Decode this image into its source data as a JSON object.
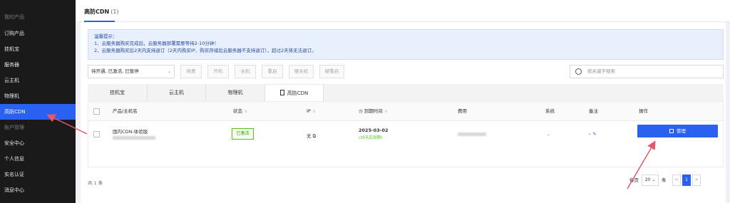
{
  "sidebar": {
    "items": [
      {
        "label": "我的产品",
        "type": "group"
      },
      {
        "label": "订购产品",
        "type": "item"
      },
      {
        "label": "挂机宝",
        "type": "item"
      },
      {
        "label": "服务器",
        "type": "item"
      },
      {
        "label": "云主机",
        "type": "item"
      },
      {
        "label": "物理机",
        "type": "item"
      },
      {
        "label": "高防CDN",
        "type": "active"
      },
      {
        "label": "账户管理",
        "type": "group"
      },
      {
        "label": "安全中心",
        "type": "item"
      },
      {
        "label": "个人信息",
        "type": "item"
      },
      {
        "label": "实名认证",
        "type": "item"
      },
      {
        "label": "消息中心",
        "type": "item"
      }
    ]
  },
  "header": {
    "title": "高防CDN",
    "count": "(1)"
  },
  "notice": {
    "title": "温馨提示：",
    "line1": "1、云服务器购买完成后，云服务器部署需要等待2-10分钟！",
    "line2": "2、云服务器购买后2天内支持退订（2天内购买IP、购买存储后云服务器不支持退订），超过2天将无法退订。"
  },
  "toolbar": {
    "status_filter": "待开通, 已激活, 已暂停",
    "buttons": [
      "续费",
      "开机",
      "关机",
      "重启",
      "硬关机",
      "硬重启"
    ],
    "search_placeholder": "按关键字搜索"
  },
  "tabs": [
    "挂机宝",
    "云主机",
    "物理机",
    "高防CDN"
  ],
  "table": {
    "columns": {
      "product": "产品/主机名",
      "status": "状态",
      "ip": "IP",
      "expiry": "到期时间",
      "fee": "费用",
      "system": "系统",
      "remark": "备注",
      "action": "操作"
    },
    "rows": [
      {
        "product": "国内CDN-体验版",
        "status": "已激活",
        "ip": "无",
        "expiry_date": "2025-03-02",
        "expiry_note": "(30天后到期)",
        "system": "-",
        "remark": "-",
        "action": "管理"
      }
    ]
  },
  "footer": {
    "total": "共 1 条",
    "per_page_label": "每页",
    "per_page": "20",
    "per_page_unit": "条",
    "prev": "<",
    "page": "1",
    "next": ">"
  },
  "colors": {
    "accent": "#2a61f0",
    "sidebar_bg": "#1a1a1a",
    "annotation_arrow": "#e8566b",
    "status_green": "#52c41a"
  }
}
